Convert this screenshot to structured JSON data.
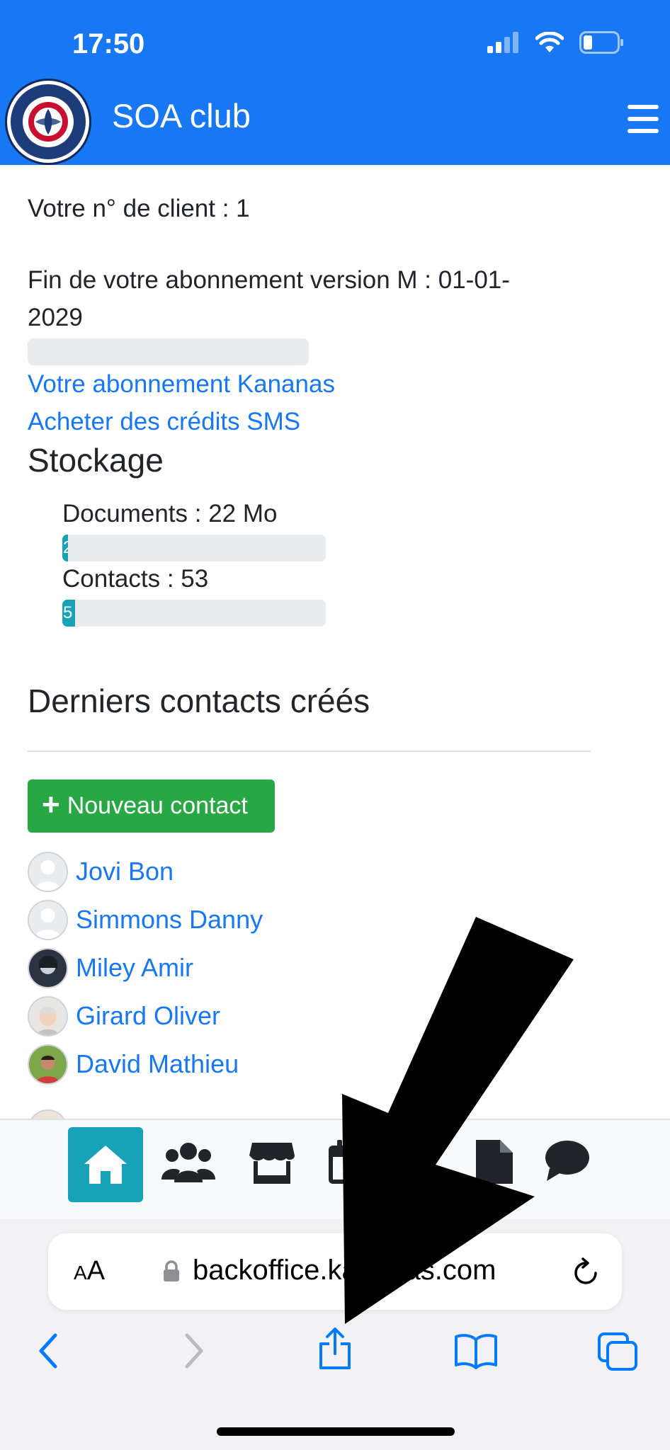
{
  "status_bar": {
    "time": "17:50"
  },
  "app": {
    "title": "SOA club"
  },
  "account": {
    "client_number": "Votre n° de client : 1",
    "subscription_end_line1": "Fin de votre abonnement version M : 01-01-",
    "subscription_end_line2": "2029",
    "link_subscription": "Votre abonnement Kananas",
    "link_sms": "Acheter des crédits SMS"
  },
  "storage": {
    "heading": "Stockage",
    "documents_label": "Documents : 22 Mo",
    "documents_bar_text": "2",
    "documents_fraction": 0.02,
    "contacts_label": "Contacts : 53",
    "contacts_bar_text": "5",
    "contacts_fraction": 0.05
  },
  "contacts_section": {
    "heading": "Derniers contacts créés",
    "new_button": "Nouveau contact",
    "items": [
      {
        "name": "Jovi Bon",
        "avatar": "default-user"
      },
      {
        "name": "Simmons Danny",
        "avatar": "default-user"
      },
      {
        "name": "Miley Amir",
        "avatar": "photo-dark"
      },
      {
        "name": "Girard Oliver",
        "avatar": "photo-light"
      },
      {
        "name": "David Mathieu",
        "avatar": "photo-green"
      }
    ]
  },
  "bottom_nav": {
    "items": [
      "home-icon",
      "users-icon",
      "store-icon",
      "calendar-icon",
      "file-icon",
      "chat-icon"
    ],
    "active": "home-icon"
  },
  "browser": {
    "text_size_label_small": "A",
    "text_size_label_large": "A",
    "url": "backoffice.kananas.com"
  },
  "colors": {
    "header": "#1877f2",
    "link": "#1877f2",
    "success": "#28a745",
    "info": "#17a2b8"
  }
}
